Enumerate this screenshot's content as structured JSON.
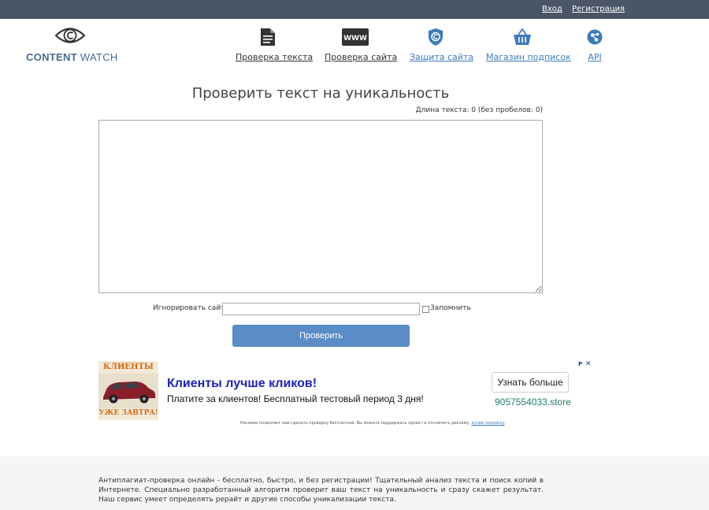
{
  "topbar": {
    "login": "Вход",
    "register": "Регистрация"
  },
  "logo": {
    "part1": "CONTENT",
    "part2": "WATCH"
  },
  "nav": [
    {
      "label": "Проверка текста",
      "icon": "document-icon"
    },
    {
      "label": "Проверка сайта",
      "icon": "www-icon"
    },
    {
      "label": "Защита сайта",
      "icon": "shield-copyright-icon"
    },
    {
      "label": "Магазин подписок",
      "icon": "basket-icon"
    },
    {
      "label": "API",
      "icon": "api-icon"
    }
  ],
  "main": {
    "title": "Проверить текст на уникальность",
    "length_text": "Длина текста: 0 (без пробелов: 0)",
    "textarea_value": "",
    "ignore_label": "Игнорировать сайт:",
    "ignore_value": "",
    "remember_label": "Запомнить",
    "remember_checked": false,
    "check_button": "Проверить"
  },
  "ad": {
    "image_top_text": "КЛИЕНТЫ",
    "image_bottom_text": "УЖЕ ЗАВТРА!",
    "headline": "Клиенты лучше кликов!",
    "subline": "Платите за клиентов! Бесплатный тестовый период 3 дня!",
    "button": "Узнать больше",
    "domain": "9057554033.store",
    "marker": "P",
    "close": "✕",
    "note": "Реклама позволяет нам сделать проверку бесплатной. Вы можете поддержать проект и отключить рекламу,",
    "note_link": "купив подписку",
    "note_end": "."
  },
  "footer": {
    "text": "Антиплагиат-проверка онлайн - бесплатно, быстро, и без регистрации! Тщательный анализ текста и поиск копий в Интернете. Специально разработанный алгоритм проверит ваш текст на уникальность и сразу скажет результат. Наш сервис умеет определять рерайт и другие способы уникализации текста."
  },
  "colors": {
    "topbar": "#4a5566",
    "link_blue": "#3d7bbd",
    "button_blue": "#5b8cc6",
    "ad_headline": "#1a23b9",
    "ad_domain": "#1f7d6e"
  }
}
